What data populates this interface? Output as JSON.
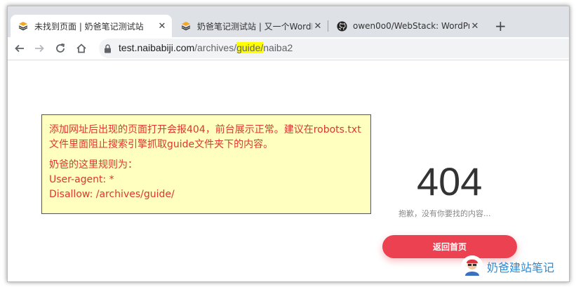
{
  "tabs": [
    {
      "title": "未找到页面 | 奶爸笔记测试站",
      "favicon": "layers-icon",
      "active": true
    },
    {
      "title": "奶爸笔记测试站 | 又一个WordPre",
      "favicon": "layers-icon",
      "active": false
    },
    {
      "title": "owen0o0/WebStack: WordPre",
      "favicon": "github-icon",
      "active": false
    }
  ],
  "new_tab_label": "+",
  "close_label": "✕",
  "address": {
    "host": "test.naibabiji.com",
    "path_before": "/archives/",
    "path_highlight": "guide/",
    "path_after": "naiba2"
  },
  "note": {
    "line1": "添加网址后出现的页面打开会报404，前台展示正常。建议在robots.txt文件里面阻止搜索引擎抓取guide文件夹下的内容。",
    "line2": "奶爸的这里规则为：",
    "line3": "User-agent: *",
    "line4": "Disallow: /archives/guide/"
  },
  "error": {
    "code": "404",
    "message": "抱歉，没有你要找的内容...",
    "home_button": "返回首页"
  },
  "watermark": "奶爸建站笔记"
}
